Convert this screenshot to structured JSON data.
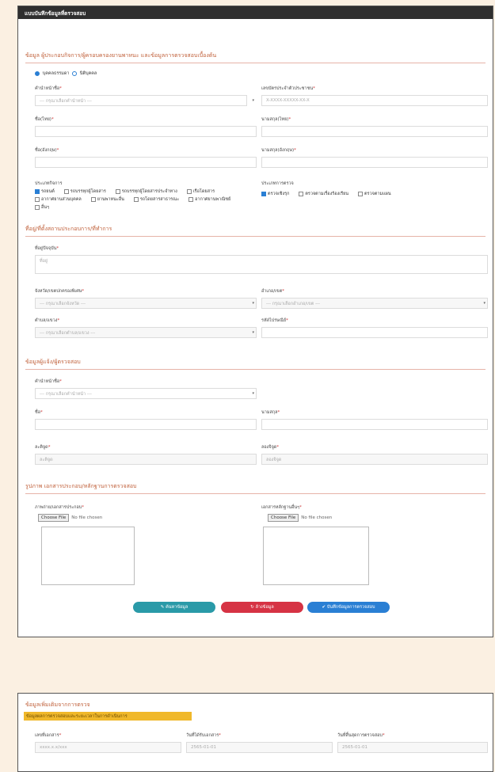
{
  "header": {
    "title": "แบบบันทึกข้อมูลที่ตรวจสอบ"
  },
  "section1": {
    "title": "ข้อมูล ผู้ประกอบกิจการ/ผู้ครอบครองยานพาหนะ และข้อมูลการตรวจสอบเบื้องต้น",
    "radio_opt1": "บุคคลธรรมดา",
    "radio_opt2": "นิติบุคคล",
    "prefix_label": "คำนำหน้าชื่อ",
    "prefix_placeholder": "--- กรุณาเลือกคำนำหน้า ---",
    "idcard_label": "เลขบัตรประจำตัวประชาชน",
    "idcard_placeholder": "X-XXXX-XXXXX-XX-X",
    "firstname_label": "ชื่อ(ไทย)",
    "firstname_en_label": "นามสกุล(ไทย)",
    "lastname_label": "ชื่อ(อังกฤษ)",
    "lastname_en_label": "นามสกุล(อังกฤษ)",
    "vehicle_type_label": "ประเภทกิจการ",
    "vehicle_types": [
      "รถยนต์",
      "รถบรรทุกผู้โดยสาร",
      "รถบรรทุกผู้โดยสารประจำทาง",
      "เรือโดยสาร",
      "อากาศยานส่วนบุคคล",
      "ยานพาหนะอื่น",
      "รถโดยสารสาธารณะ",
      "อากาศยานพาณิชย์",
      "อื่นๆ"
    ],
    "inspect_type_label": "ประเภทการตรวจ",
    "inspect_types": [
      "ตรวจเชิงรุก",
      "ตรวจตามเรื่องร้องเรียน",
      "ตรวจตามแผน"
    ]
  },
  "section2": {
    "title": "ที่อยู่/ที่ตั้งสถานประกอบการ/ที่ทำการ",
    "address_label": "ที่อยู่ปัจจุบัน",
    "address_placeholder": "ที่อยู่",
    "province_label": "จังหวัด/เขตปกครองพิเศษ",
    "province_placeholder": "--- กรุณาเลือกจังหวัด ---",
    "district_label": "อำเภอ/เขต",
    "district_placeholder": "--- กรุณาเลือกอำเภอ/เขต ---",
    "subdistrict_label": "ตำบล/แขวง",
    "subdistrict_placeholder": "--- กรุณาเลือกตำบล/แขวง ---",
    "postcode_label": "รหัสไปรษณีย์"
  },
  "section3": {
    "title": "ข้อมูลผู้แจ้ง/ผู้ตรวจสอบ",
    "prefix_label": "คำนำหน้าชื่อ",
    "prefix_placeholder": "--- กรุณาเลือกคำนำหน้า ---",
    "name_label": "ชื่อ",
    "surname_label": "นามสกุล",
    "lat_label": "ละติจูด",
    "lat_placeholder": "ละติจูด",
    "lng_label": "ลองจิจูด",
    "lng_placeholder": "ลองจิจูด"
  },
  "section4": {
    "title": "รูปภาพ เอกสารประกอบ/หลักฐานการตรวจสอบ",
    "file1_label": "ภาพถ่าย/เอกสารประกอบ",
    "file2_label": "เอกสารหลักฐานอื่นๆ",
    "choose_file": "Choose File",
    "no_file": "No file chosen"
  },
  "buttons": {
    "search": "ค้นหาข้อมูล",
    "reset": "ล้างข้อมูล",
    "save": "บันทึกข้อมูลการตรวจสอบ"
  },
  "card2": {
    "title": "ข้อมูลเพิ่มเติมจากการตรวจ",
    "highlight": "ข้อมูลผลการตรวจสอบและระยะเวลาในการดำเนินการ",
    "field1_label": "เลขที่เอกสาร",
    "field1_value": "xxxx.x.x/xxx",
    "field2_label": "วันที่ได้รับเอกสาร",
    "field2_value": "2565-01-01",
    "field3_label": "วันที่สิ้นสุดการตรวจสอบ",
    "field3_value": "2565-01-01"
  },
  "colors": {
    "header_bg": "#2f2f2f",
    "section_title": "#c0603a",
    "btn_search": "#2a9aa8",
    "btn_reset": "#d63344",
    "btn_save": "#2a7fd4",
    "highlight": "#f0b82b",
    "page_bg": "#fbf0e2"
  },
  "icons": {
    "search_button": "search-icon",
    "reset_button": "reset-icon",
    "save_button": "save-icon"
  }
}
